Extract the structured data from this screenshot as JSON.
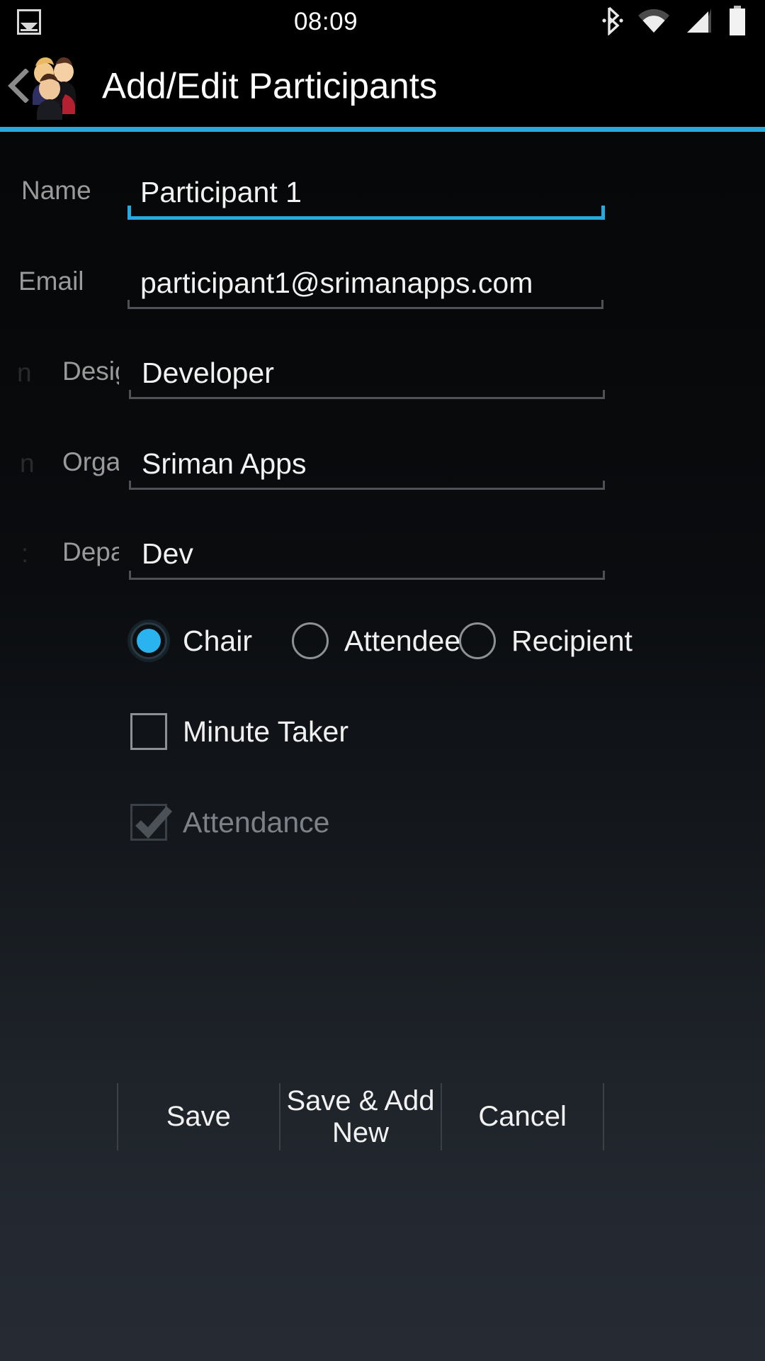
{
  "status_bar": {
    "time": "08:09",
    "icons": {
      "notification": "photo-icon",
      "bluetooth": "bluetooth-icon",
      "wifi": "wifi-icon",
      "cellular": "cellular-signal-icon",
      "battery": "battery-full-icon"
    }
  },
  "title_bar": {
    "back": "back-chevron-icon",
    "app_icon": "participants-group-icon",
    "title": "Add/Edit Participants",
    "accent_color": "#29a8dd"
  },
  "form": {
    "fields": [
      {
        "label": "Name",
        "ghost": "",
        "value": "Participant 1",
        "focused": true
      },
      {
        "label": "Email",
        "ghost": "",
        "value": "participant1@srimanapps.com",
        "focused": false
      },
      {
        "label": "Design",
        "ghost": "n",
        "value": "Developer",
        "focused": false
      },
      {
        "label": "Organ",
        "ghost": "n",
        "value": "Sriman Apps",
        "focused": false
      },
      {
        "label": "Depart",
        "ghost": ":",
        "value": "Dev",
        "focused": false
      }
    ]
  },
  "roles": {
    "options": [
      {
        "label": "Chair",
        "selected": true
      },
      {
        "label": "Attendee",
        "selected": false
      },
      {
        "label": "Recipient",
        "selected": false
      }
    ]
  },
  "checkboxes": [
    {
      "label": "Minute Taker",
      "checked": false,
      "disabled": false
    },
    {
      "label": "Attendance",
      "checked": true,
      "disabled": true
    }
  ],
  "buttons": [
    {
      "label": "Save"
    },
    {
      "label": "Save & Add New"
    },
    {
      "label": "Cancel"
    }
  ]
}
